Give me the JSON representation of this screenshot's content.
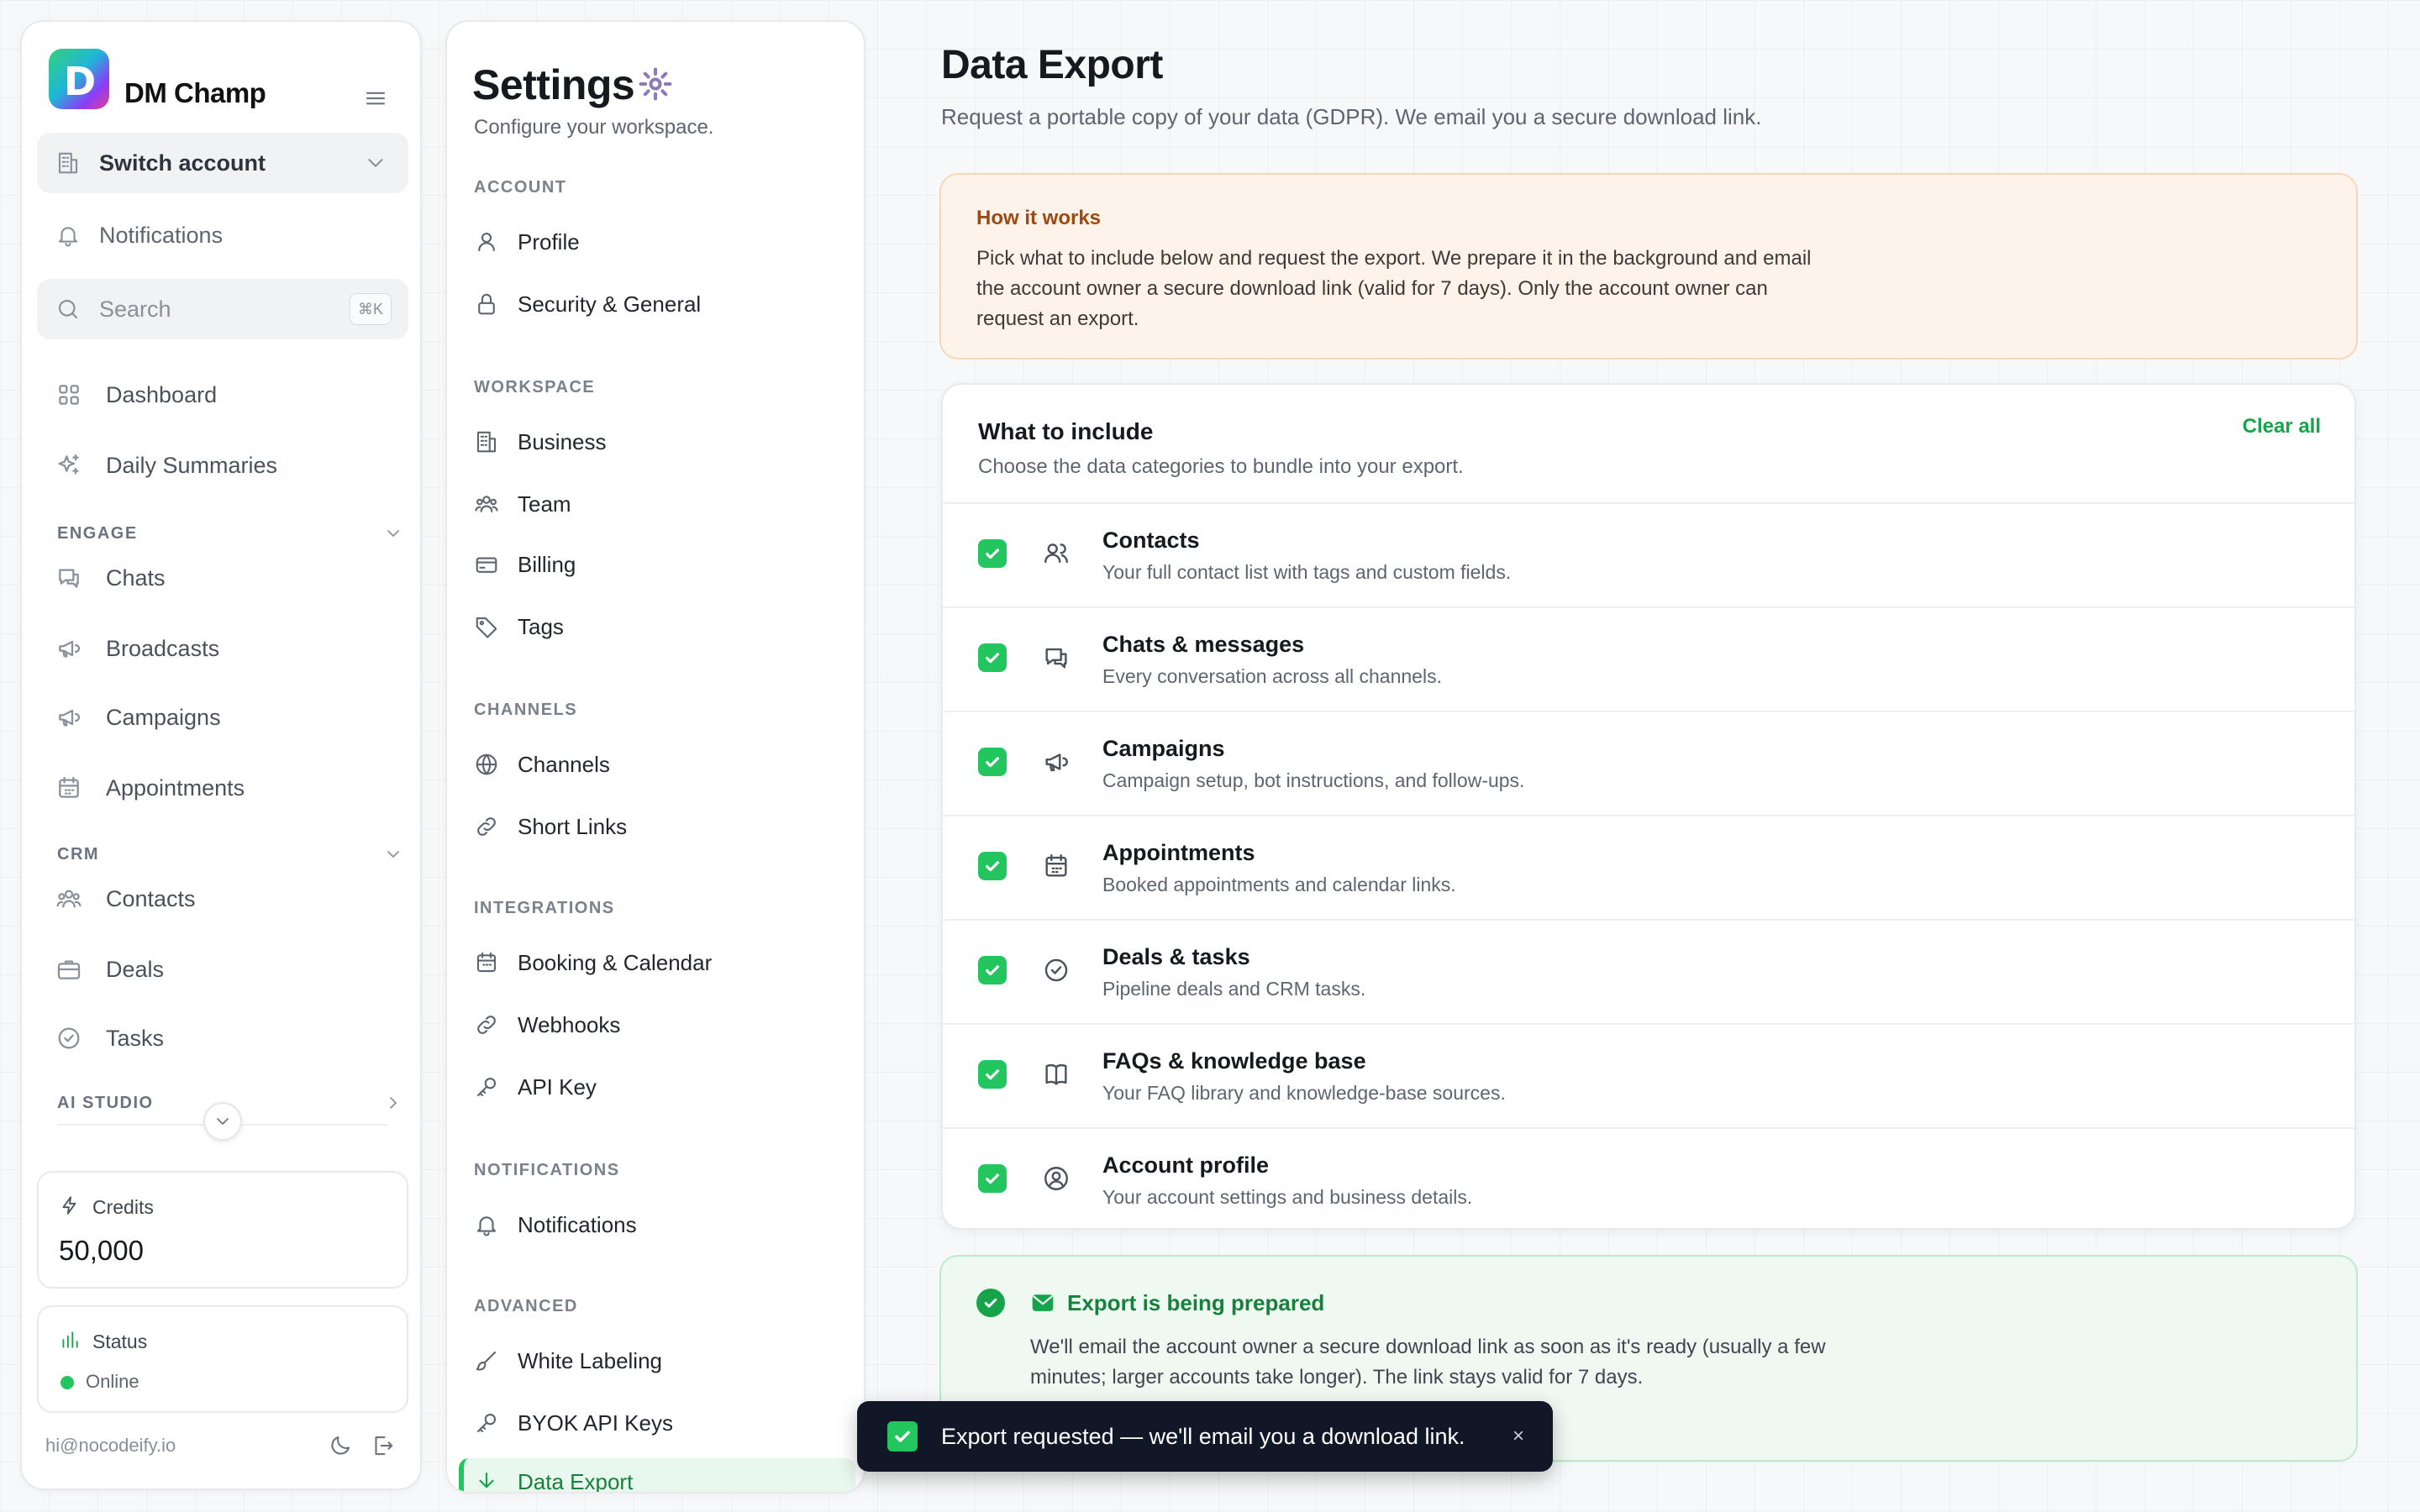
{
  "brand": {
    "logo_letter": "D",
    "name": "DM Champ"
  },
  "sidebar": {
    "switch_account": "Switch account",
    "notifications": "Notifications",
    "search_placeholder": "Search",
    "search_shortcut": "⌘K",
    "top_items": [
      {
        "label": "Dashboard",
        "icon": "grid-icon"
      },
      {
        "label": "Daily Summaries",
        "icon": "sparkles-icon"
      }
    ],
    "sections": {
      "engage": "ENGAGE",
      "crm": "CRM",
      "ai_studio": "AI STUDIO"
    },
    "engage_items": [
      {
        "label": "Chats",
        "icon": "chat-icon"
      },
      {
        "label": "Broadcasts",
        "icon": "megaphone-icon"
      },
      {
        "label": "Campaigns",
        "icon": "megaphone-icon"
      },
      {
        "label": "Appointments",
        "icon": "calendar-icon"
      }
    ],
    "crm_items": [
      {
        "label": "Contacts",
        "icon": "users-icon"
      },
      {
        "label": "Deals",
        "icon": "briefcase-icon"
      },
      {
        "label": "Tasks",
        "icon": "check-circle-icon"
      }
    ],
    "credits": {
      "label": "Credits",
      "value": "50,000"
    },
    "status": {
      "label": "Status",
      "value": "Online",
      "color": "#22c55e"
    },
    "user_email": "hi@nocodeify.io"
  },
  "settings": {
    "title": "Settings",
    "subtitle": "Configure your workspace.",
    "groups": {
      "account": "ACCOUNT",
      "workspace": "WORKSPACE",
      "channels": "CHANNELS",
      "integrations": "INTEGRATIONS",
      "notifications": "NOTIFICATIONS",
      "advanced": "ADVANCED"
    },
    "items": {
      "profile": "Profile",
      "security": "Security & General",
      "business": "Business",
      "team": "Team",
      "billing": "Billing",
      "tags": "Tags",
      "channels": "Channels",
      "short_links": "Short Links",
      "booking": "Booking & Calendar",
      "webhooks": "Webhooks",
      "api_key": "API Key",
      "notifications": "Notifications",
      "white_labeling": "White Labeling",
      "byok": "BYOK API Keys",
      "data_export": "Data Export"
    }
  },
  "main": {
    "title": "Data Export",
    "subtitle": "Request a portable copy of your data (GDPR). We email you a secure download link.",
    "how": {
      "title": "How it works",
      "body": "Pick what to include below and request the export. We prepare it in the background and email the account owner a secure download link (valid for 7 days). Only the account owner can request an export."
    },
    "include": {
      "title": "What to include",
      "subtitle": "Choose the data categories to bundle into your export.",
      "clear_label": "Clear all",
      "options": [
        {
          "title": "Contacts",
          "desc": "Your full contact list with tags and custom fields.",
          "checked": true
        },
        {
          "title": "Chats & messages",
          "desc": "Every conversation across all channels.",
          "checked": true
        },
        {
          "title": "Campaigns",
          "desc": "Campaign setup, bot instructions, and follow-ups.",
          "checked": true
        },
        {
          "title": "Appointments",
          "desc": "Booked appointments and calendar links.",
          "checked": true
        },
        {
          "title": "Deals & tasks",
          "desc": "Pipeline deals and CRM tasks.",
          "checked": true
        },
        {
          "title": "FAQs & knowledge base",
          "desc": "Your FAQ library and knowledge-base sources.",
          "checked": true
        },
        {
          "title": "Account profile",
          "desc": "Your account settings and business details.",
          "checked": true
        }
      ]
    },
    "prepared": {
      "title": "Export is being prepared",
      "body": "We'll email the account owner a secure download link as soon as it's ready (usually a few minutes; larger accounts take longer). The link stays valid for 7 days."
    }
  },
  "toast": {
    "message": "Export requested — we'll email you a download link.",
    "close": "×"
  },
  "colors": {
    "accent": "#22c55e",
    "warning_bg": "#fdf3ea",
    "success_bg": "#eefaf1",
    "toast_bg": "#101828"
  }
}
